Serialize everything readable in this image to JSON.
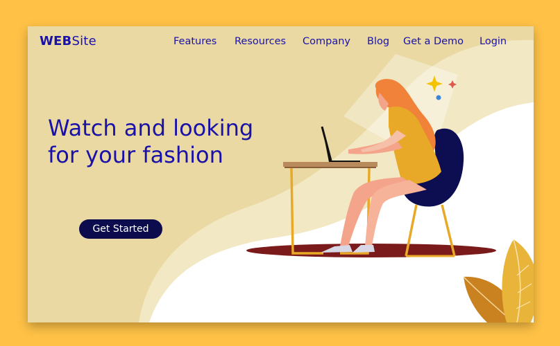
{
  "site": {
    "logo_bold": "WEB",
    "logo_light": "Site"
  },
  "nav": {
    "items": [
      "Features",
      "Resources",
      "Company",
      "Blog",
      "Get a Demo",
      "Login"
    ]
  },
  "hero": {
    "title_line1": "Watch and looking",
    "title_line2": "for your fashion",
    "cta_label": "Get Started"
  },
  "colors": {
    "outer_background": "#FFC247",
    "page_background": "#EAD9A2",
    "brand_text": "#1A12A8",
    "button_background": "#0B0B4D",
    "button_text": "#FFFFFF"
  },
  "illustration": {
    "subject": "woman-working-on-laptop-at-desk",
    "icons": [
      "sparkle-icon",
      "leaf-icon"
    ]
  }
}
